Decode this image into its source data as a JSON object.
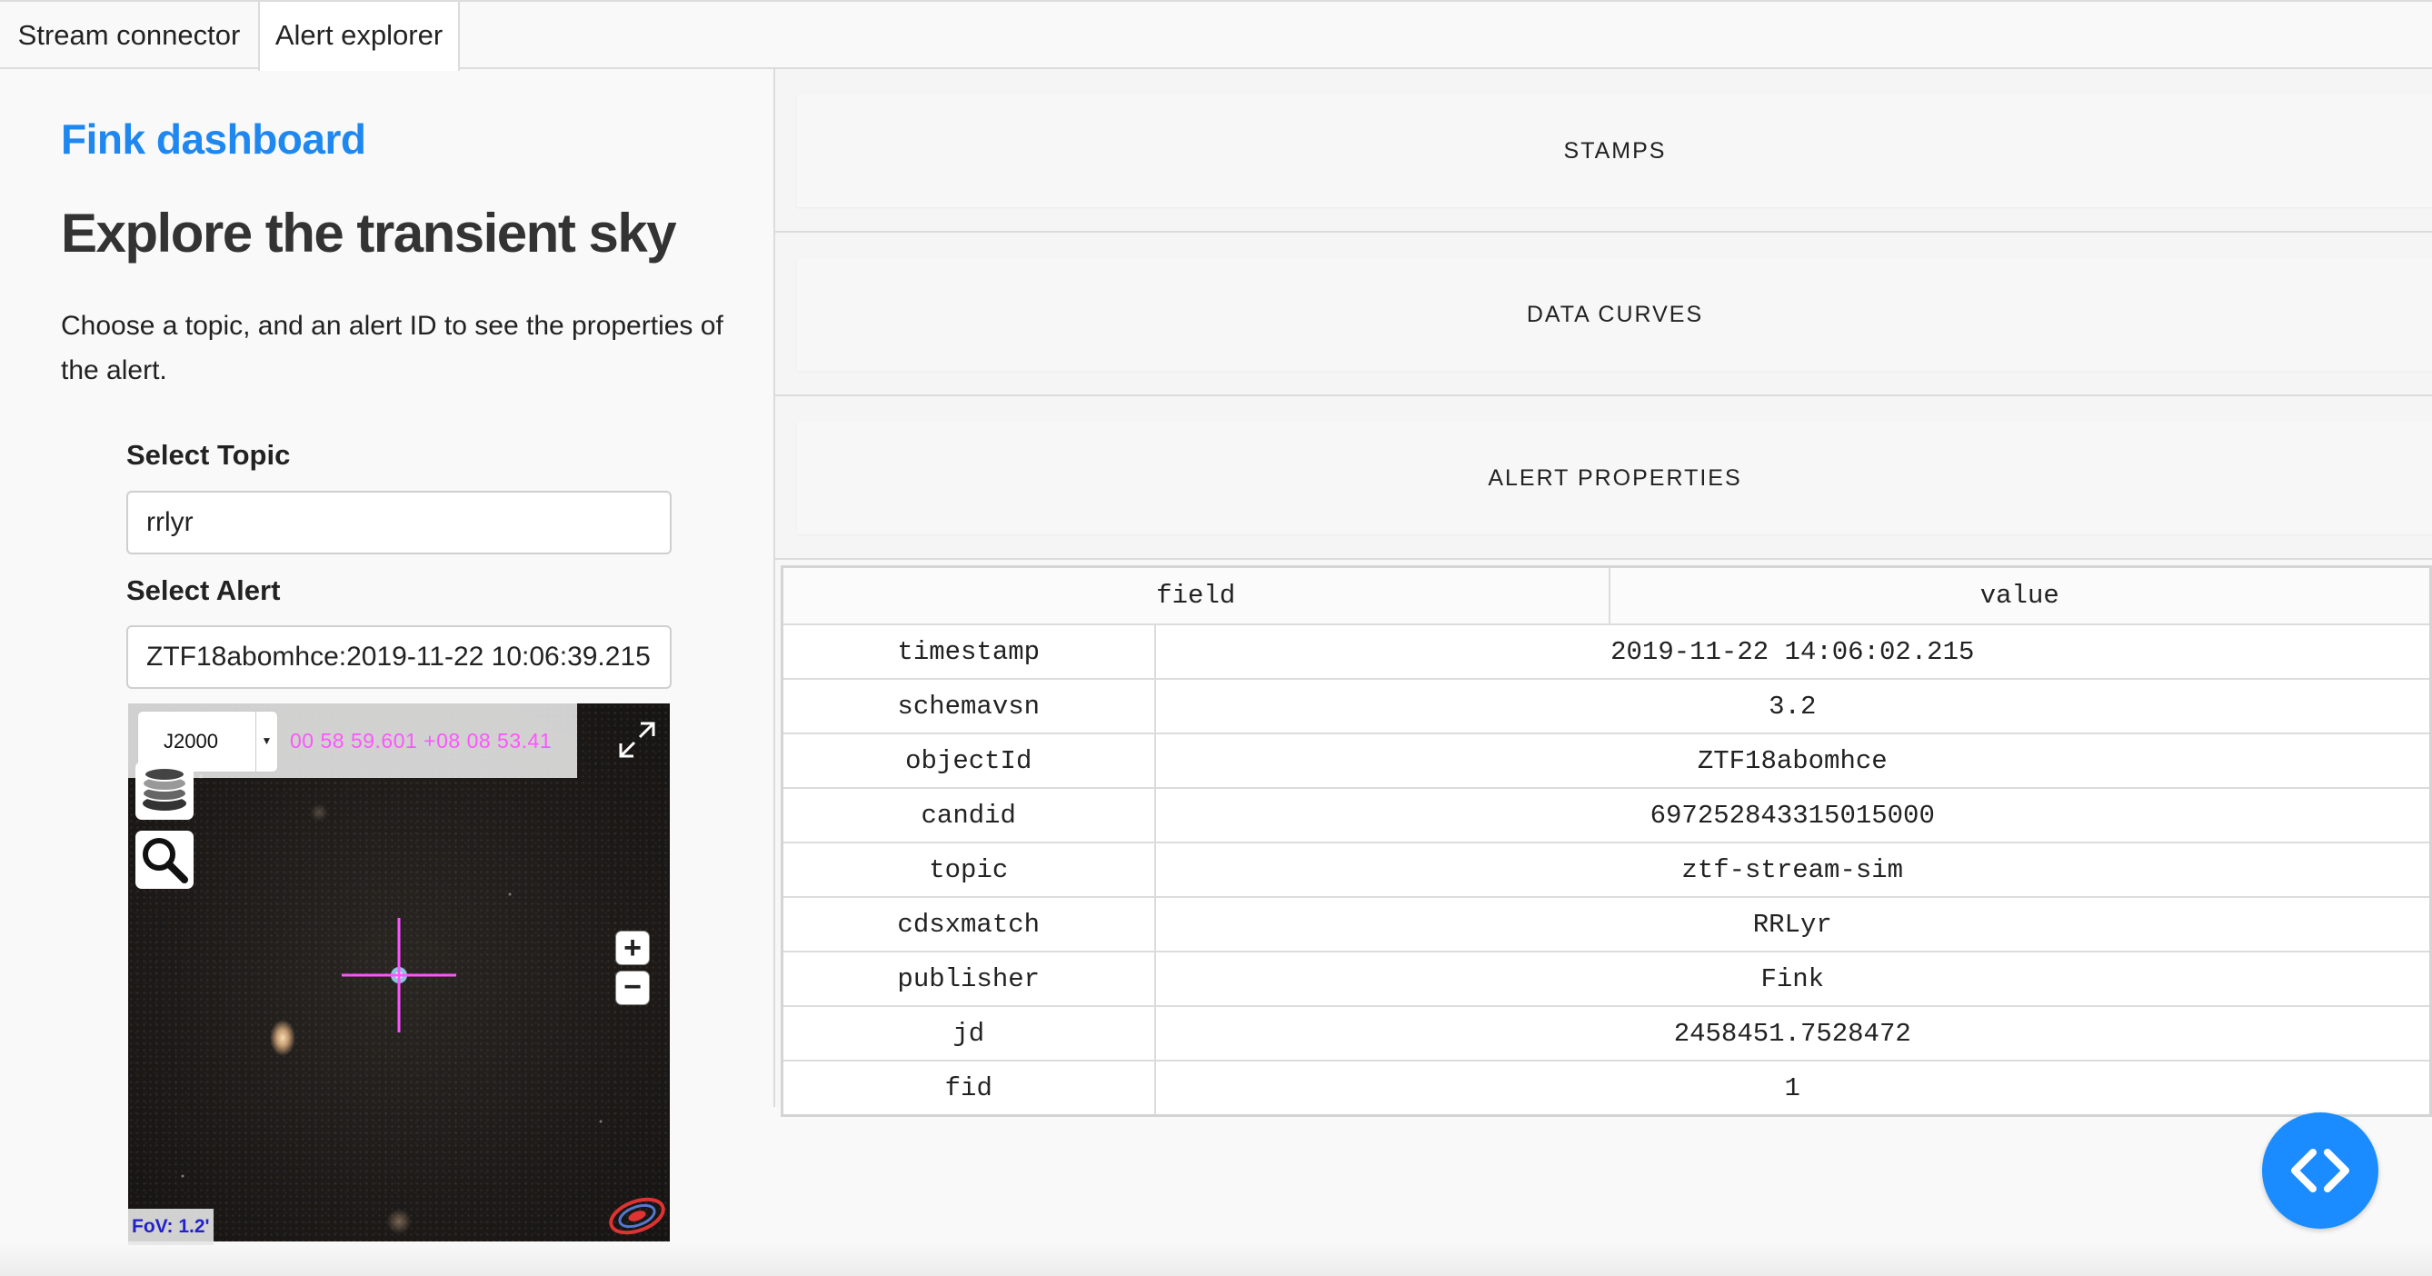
{
  "tabs": [
    {
      "label": "Stream connector",
      "active": false
    },
    {
      "label": "Alert explorer",
      "active": true
    }
  ],
  "sidebar": {
    "brand": "Fink dashboard",
    "title": "Explore the transient sky",
    "description": "Choose a topic, and an alert ID to see the properties of the alert.",
    "topic_label": "Select Topic",
    "topic_value": "rrlyr",
    "alert_label": "Select Alert",
    "alert_value": "ZTF18abomhce:2019-11-22 10:06:39.215"
  },
  "sky_viewer": {
    "frame": "J2000",
    "coordinates": "00 58 59.601 +08 08 53.41",
    "fov": "FoV: 1.2'",
    "icons": [
      "layers-icon",
      "search-icon",
      "expand-icon",
      "zoom-in-icon",
      "zoom-out-icon",
      "aladin-logo-icon"
    ],
    "crosshair_color": "#ff55ff"
  },
  "sections": {
    "stamps": "STAMPS",
    "data_curves": "DATA CURVES",
    "alert_properties": "ALERT PROPERTIES"
  },
  "properties_table": {
    "headers": [
      "field",
      "value"
    ],
    "rows": [
      {
        "field": "timestamp",
        "value": "2019-11-22 14:06:02.215"
      },
      {
        "field": "schemavsn",
        "value": "3.2"
      },
      {
        "field": "objectId",
        "value": "ZTF18abomhce"
      },
      {
        "field": "candid",
        "value": "697252843315015000"
      },
      {
        "field": "topic",
        "value": "ztf-stream-sim"
      },
      {
        "field": "cdsxmatch",
        "value": "RRLyr"
      },
      {
        "field": "publisher",
        "value": "Fink"
      },
      {
        "field": "jd",
        "value": "2458451.7528472"
      },
      {
        "field": "fid",
        "value": "1"
      }
    ]
  },
  "code_button": {
    "icon": "code-brackets-icon"
  },
  "colors": {
    "brand": "#1e88f0",
    "fab": "#1a8cff",
    "coords": "#ff55ff",
    "fov": "#2222cc"
  }
}
